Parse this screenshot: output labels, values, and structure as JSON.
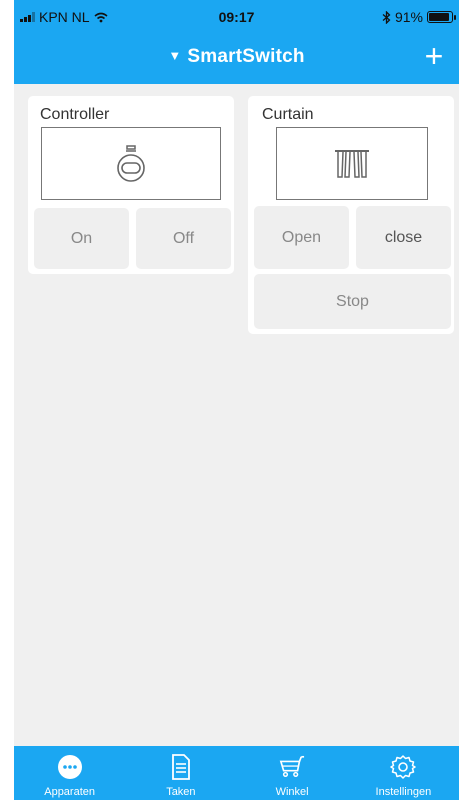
{
  "status_bar": {
    "carrier": "KPN NL",
    "time": "09:17",
    "battery": "91%",
    "battery_level": 0.91
  },
  "header": {
    "caret": "▼",
    "title": "SmartSwitch",
    "add_label": "+"
  },
  "devices": [
    {
      "name": "Controller",
      "icon": "plug-icon",
      "buttons": [
        "On",
        "Off"
      ]
    },
    {
      "name": "Curtain",
      "icon": "curtain-icon",
      "buttons": [
        "Open",
        "close",
        "Stop"
      ]
    }
  ],
  "tabs": [
    {
      "label": "Apparaten",
      "icon": "devices-icon",
      "active": true
    },
    {
      "label": "Taken",
      "icon": "document-icon",
      "active": false
    },
    {
      "label": "Winkel",
      "icon": "cart-icon",
      "active": false
    },
    {
      "label": "Instellingen",
      "icon": "gear-icon",
      "active": false
    }
  ],
  "colors": {
    "primary": "#1ba7f2",
    "background": "#f0f0f0",
    "card": "#ffffff",
    "button": "#efefef"
  }
}
